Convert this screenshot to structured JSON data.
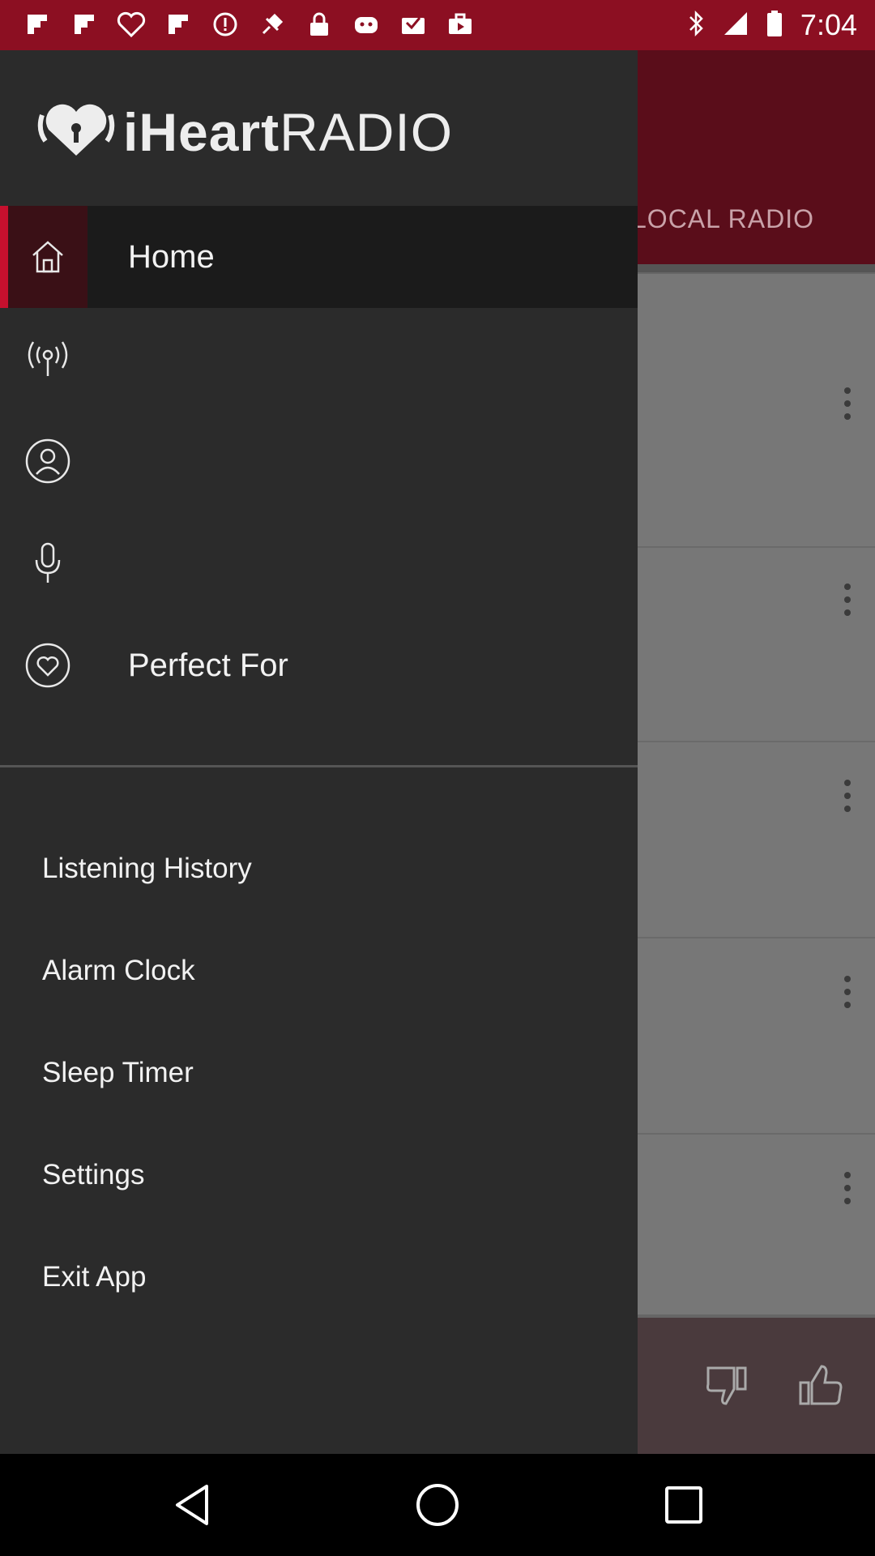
{
  "status_bar": {
    "time": "7:04",
    "icons": [
      "flipboard-icon",
      "flipboard-icon",
      "iheart-icon",
      "flipboard-icon",
      "alert-icon",
      "fake-gps-icon",
      "lock-icon",
      "android-icon",
      "inbox-icon",
      "briefcase-icon"
    ],
    "bluetooth": "bluetooth-icon",
    "signal": "signal-icon",
    "battery": "battery-icon"
  },
  "background": {
    "tab_label": "LOCAL RADIO",
    "rows": 5
  },
  "drawer": {
    "logo_text_bold": "iHeart",
    "logo_text_light": "RADIO",
    "nav": [
      {
        "icon": "home-icon",
        "label": "Home"
      },
      {
        "icon": "radio-broadcast-icon",
        "label": ""
      },
      {
        "icon": "user-icon",
        "label": ""
      },
      {
        "icon": "microphone-icon",
        "label": ""
      },
      {
        "icon": "heart-icon",
        "label": "Perfect For"
      }
    ],
    "menu": [
      {
        "label": "Listening History"
      },
      {
        "label": "Alarm Clock"
      },
      {
        "label": "Sleep Timer"
      },
      {
        "label": "Settings"
      },
      {
        "label": "Exit App"
      }
    ]
  },
  "player": {
    "thumbs_down": "thumbs-down-icon",
    "thumbs_up": "thumbs-up-icon"
  },
  "colors": {
    "brand_red": "#c6102e",
    "drawer_bg": "#2b2b2b",
    "status_bar": "#8c0f22"
  }
}
